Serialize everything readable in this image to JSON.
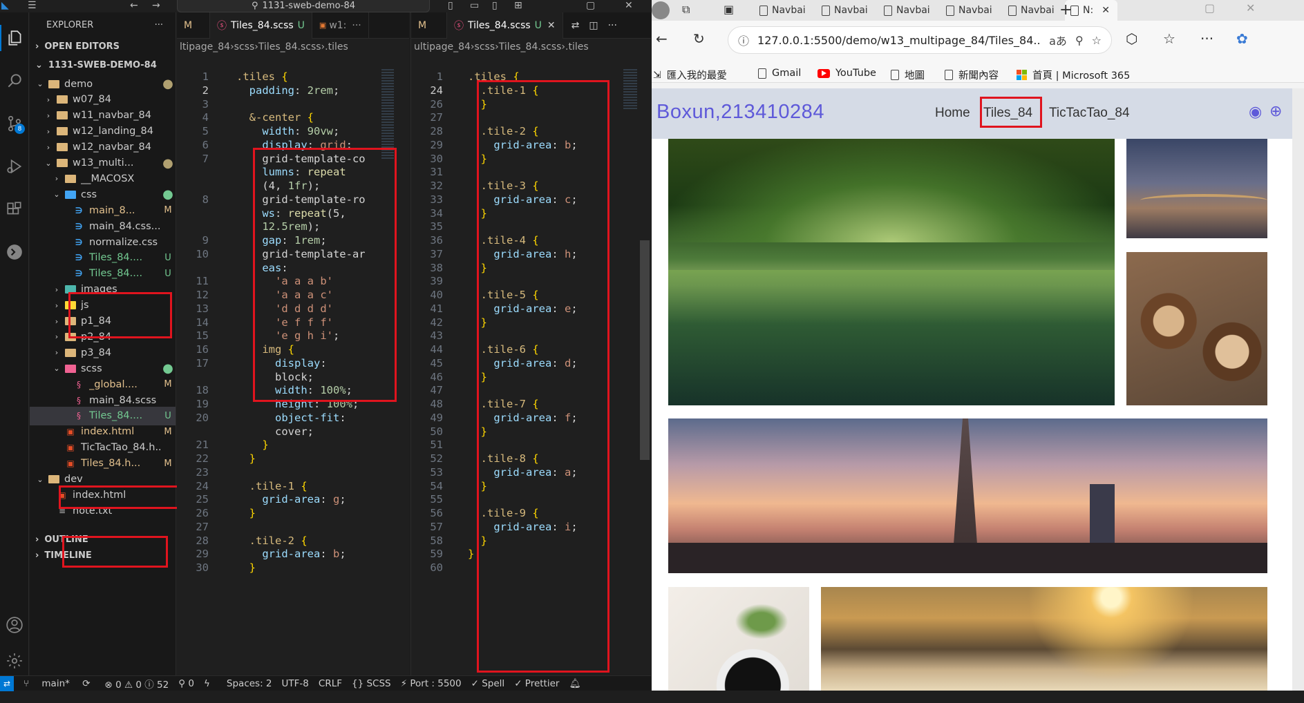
{
  "vscode": {
    "title_search": "1131-sweb-demo-84",
    "activity_badge": "8",
    "explorer": {
      "title": "EXPLORER",
      "more": "···",
      "open_editors": "OPEN EDITORS",
      "workspace": "1131-SWEB-DEMO-84",
      "outline": "OUTLINE",
      "timeline": "TIMELINE",
      "tree": [
        {
          "label": "demo",
          "status": "●"
        },
        {
          "label": "w07_84",
          "status": ""
        },
        {
          "label": "w11_navbar_84",
          "status": ""
        },
        {
          "label": "w12_landing_84",
          "status": ""
        },
        {
          "label": "w12_navbar_84",
          "status": ""
        },
        {
          "label": "w13_multi...",
          "status": "●"
        },
        {
          "label": "__MACOSX",
          "status": ""
        },
        {
          "label": "css",
          "status": "●"
        },
        {
          "label": "main_8...",
          "status": "M"
        },
        {
          "label": "main_84.css....",
          "status": ""
        },
        {
          "label": "normalize.css",
          "status": ""
        },
        {
          "label": "Tiles_84....",
          "status": "U"
        },
        {
          "label": "Tiles_84....",
          "status": "U"
        },
        {
          "label": "images",
          "status": ""
        },
        {
          "label": "js",
          "status": ""
        },
        {
          "label": "p1_84",
          "status": ""
        },
        {
          "label": "p2_84",
          "status": ""
        },
        {
          "label": "p3_84",
          "status": ""
        },
        {
          "label": "scss",
          "status": "●"
        },
        {
          "label": "_global....",
          "status": "M"
        },
        {
          "label": "main_84.scss",
          "status": ""
        },
        {
          "label": "Tiles_84....",
          "status": "U"
        },
        {
          "label": "index.html",
          "status": "M"
        },
        {
          "label": "TicTacTao_84.h...",
          "status": ""
        },
        {
          "label": "Tiles_84.h...",
          "status": "M"
        },
        {
          "label": "dev",
          "status": ""
        },
        {
          "label": "index.html",
          "status": ""
        },
        {
          "label": "note.txt",
          "status": ""
        }
      ]
    },
    "left_editor": {
      "tab_partial": "M",
      "tab_active": "Tiles_84.scss",
      "tab_active_status": "U",
      "tab_next": "w1:",
      "tab_more": "···",
      "breadcrumb": [
        "ltipage_84",
        "scss",
        "Tiles_84.scss",
        ".tiles"
      ],
      "lines": [
        {
          "n": "1",
          "t": ".tiles {"
        },
        {
          "n": "2",
          "t": "  padding: 2rem;"
        },
        {
          "n": "3",
          "t": ""
        },
        {
          "n": "4",
          "t": "  &-center {"
        },
        {
          "n": "5",
          "t": "    width: 90vw;"
        },
        {
          "n": "6",
          "t": "    display: grid;"
        },
        {
          "n": "7",
          "t": "    grid-template-co"
        },
        {
          "n": "",
          "t": "    lumns: repeat"
        },
        {
          "n": "",
          "t": "    (4, 1fr);"
        },
        {
          "n": "8",
          "t": "    grid-template-ro"
        },
        {
          "n": "",
          "t": "    ws: repeat(5,"
        },
        {
          "n": "",
          "t": "    12.5rem);"
        },
        {
          "n": "9",
          "t": "    gap: 1rem;"
        },
        {
          "n": "10",
          "t": "    grid-template-ar"
        },
        {
          "n": "",
          "t": "    eas:"
        },
        {
          "n": "11",
          "t": "      'a a a b'"
        },
        {
          "n": "12",
          "t": "      'a a a c'"
        },
        {
          "n": "13",
          "t": "      'd d d d'"
        },
        {
          "n": "14",
          "t": "      'e f f f'"
        },
        {
          "n": "15",
          "t": "      'e g h i';"
        },
        {
          "n": "16",
          "t": "    img {"
        },
        {
          "n": "17",
          "t": "      display:"
        },
        {
          "n": "",
          "t": "      block;"
        },
        {
          "n": "18",
          "t": "      width: 100%;"
        },
        {
          "n": "19",
          "t": "      height: 100%;"
        },
        {
          "n": "20",
          "t": "      object-fit:"
        },
        {
          "n": "",
          "t": "      cover;"
        },
        {
          "n": "21",
          "t": "    }"
        },
        {
          "n": "22",
          "t": "  }"
        },
        {
          "n": "23",
          "t": ""
        },
        {
          "n": "24",
          "t": "  .tile-1 {"
        },
        {
          "n": "25",
          "t": "    grid-area: g;"
        },
        {
          "n": "26",
          "t": "  }"
        },
        {
          "n": "27",
          "t": ""
        },
        {
          "n": "28",
          "t": "  .tile-2 {"
        },
        {
          "n": "29",
          "t": "    grid-area: b;"
        },
        {
          "n": "30",
          "t": "  }"
        }
      ]
    },
    "right_editor": {
      "tab_partial": "M",
      "tab_active": "Tiles_84.scss",
      "tab_active_status": "U",
      "breadcrumb": [
        "ultipage_84",
        "scss",
        "Tiles_84.scss",
        ".tiles"
      ],
      "lines": [
        {
          "n": "1",
          "t": ".tiles {"
        },
        {
          "n": "24",
          "t": "  .tile-1 {"
        },
        {
          "n": "26",
          "t": "  }"
        },
        {
          "n": "27",
          "t": ""
        },
        {
          "n": "28",
          "t": "  .tile-2 {"
        },
        {
          "n": "29",
          "t": "    grid-area: b;"
        },
        {
          "n": "30",
          "t": "  }"
        },
        {
          "n": "31",
          "t": ""
        },
        {
          "n": "32",
          "t": "  .tile-3 {"
        },
        {
          "n": "33",
          "t": "    grid-area: c;"
        },
        {
          "n": "34",
          "t": "  }"
        },
        {
          "n": "35",
          "t": ""
        },
        {
          "n": "36",
          "t": "  .tile-4 {"
        },
        {
          "n": "37",
          "t": "    grid-area: h;"
        },
        {
          "n": "38",
          "t": "  }"
        },
        {
          "n": "39",
          "t": ""
        },
        {
          "n": "40",
          "t": "  .tile-5 {"
        },
        {
          "n": "41",
          "t": "    grid-area: e;"
        },
        {
          "n": "42",
          "t": "  }"
        },
        {
          "n": "43",
          "t": ""
        },
        {
          "n": "44",
          "t": "  .tile-6 {"
        },
        {
          "n": "45",
          "t": "    grid-area: d;"
        },
        {
          "n": "46",
          "t": "  }"
        },
        {
          "n": "47",
          "t": ""
        },
        {
          "n": "48",
          "t": "  .tile-7 {"
        },
        {
          "n": "49",
          "t": "    grid-area: f;"
        },
        {
          "n": "50",
          "t": "  }"
        },
        {
          "n": "51",
          "t": ""
        },
        {
          "n": "52",
          "t": "  .tile-8 {"
        },
        {
          "n": "53",
          "t": "    grid-area: a;"
        },
        {
          "n": "54",
          "t": "  }"
        },
        {
          "n": "55",
          "t": ""
        },
        {
          "n": "56",
          "t": "  .tile-9 {"
        },
        {
          "n": "57",
          "t": "    grid-area: i;"
        },
        {
          "n": "58",
          "t": "  }"
        },
        {
          "n": "59",
          "t": "}"
        },
        {
          "n": "60",
          "t": ""
        }
      ]
    },
    "status": {
      "branch": "main*",
      "problems": "⊗ 0 ⚠ 0 ⓘ 52",
      "ports": "⚲ 0",
      "spaces": "Spaces: 2",
      "encoding": "UTF-8",
      "eol": "CRLF",
      "language": "{} SCSS",
      "port": "⚡ Port : 5500",
      "spell": "✓ Spell",
      "prettier": "✓ Prettier"
    }
  },
  "browser": {
    "tabs": [
      "Navbai",
      "Navbai",
      "Navbai",
      "Navbai",
      "Navbai",
      "N:"
    ],
    "url": "127.0.0.1:5500/demo/w13_multipage_84/Tiles_84....",
    "favorites": [
      "匯入我的最愛",
      "Gmail",
      "YouTube",
      "地圖",
      "新聞內容",
      "首頁 | Microsoft 365"
    ],
    "page": {
      "brand": "Boxun,213410284",
      "nav": [
        "Home",
        "Tiles_84",
        "TicTacTao_84"
      ]
    }
  }
}
